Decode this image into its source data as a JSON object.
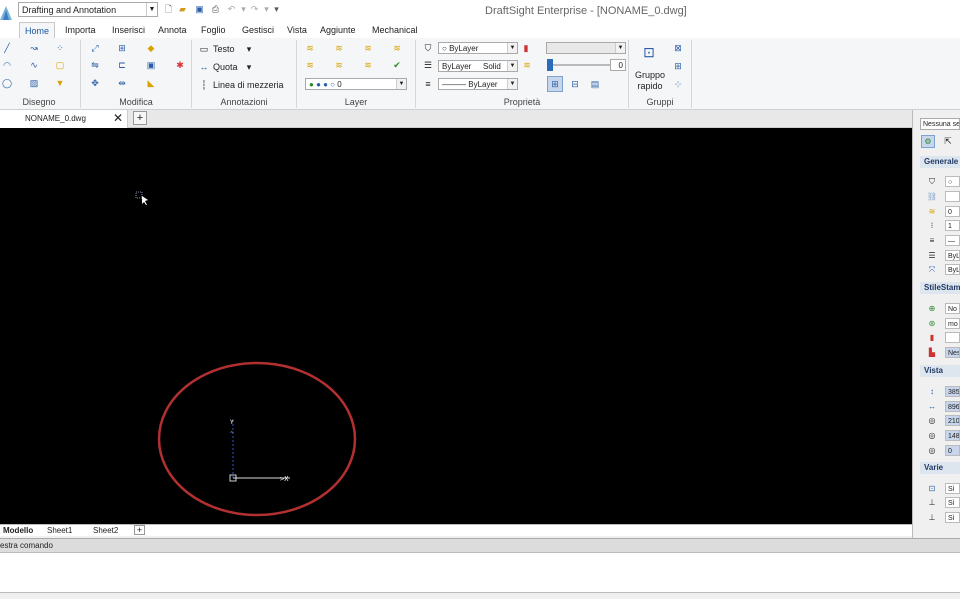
{
  "titlebar": {
    "workspace": "Drafting and Annotation",
    "title": "DraftSight Enterprise - [NONAME_0.dwg]"
  },
  "ribbon_tabs": [
    "Home",
    "Importa",
    "Inserisci",
    "Annota",
    "Foglio",
    "Gestisci",
    "Vista",
    "Aggiunte",
    "Mechanical"
  ],
  "panels": {
    "disegno": "Disegno",
    "modifica": "Modifica",
    "annotazioni": "Annotazioni",
    "layer": "Layer",
    "proprieta": "Proprietà",
    "gruppi": "Gruppi"
  },
  "annotazioni": {
    "testo": "Testo",
    "quota": "Quota",
    "linea": "Linea di mezzeria"
  },
  "layer": {
    "current": "0"
  },
  "proprieta": {
    "color": "ByLayer",
    "linetype": "ByLayer",
    "linestyle": "Solid",
    "lineweight": "ByLayer",
    "transparency": "0"
  },
  "gruppi": {
    "gruppo_rapido": "Gruppo rapido"
  },
  "document_tab": "NONAME_0.dwg",
  "layout_tabs": [
    "Modello",
    "Sheet1",
    "Sheet2"
  ],
  "command_window": {
    "title": "estra comando"
  },
  "properties_panel": {
    "selection": "Nessuna se",
    "sections": {
      "generale": "Generale",
      "stilestampa": "StileStam",
      "vista": "Vista",
      "varie": "Varie"
    },
    "generale_values": [
      "○",
      "",
      "0",
      "1",
      "—",
      "ByL",
      "ByL"
    ],
    "stile_values": [
      "No",
      "mo",
      "",
      "Nes"
    ],
    "vista_values": [
      "385",
      "896",
      "210",
      "148",
      "0"
    ],
    "varie_values": [
      "Sì",
      "Sì",
      "Sì"
    ]
  },
  "colors": {
    "canvas": "#000000",
    "accent": "#1a57a0",
    "highlight_circle": "#b33030"
  }
}
